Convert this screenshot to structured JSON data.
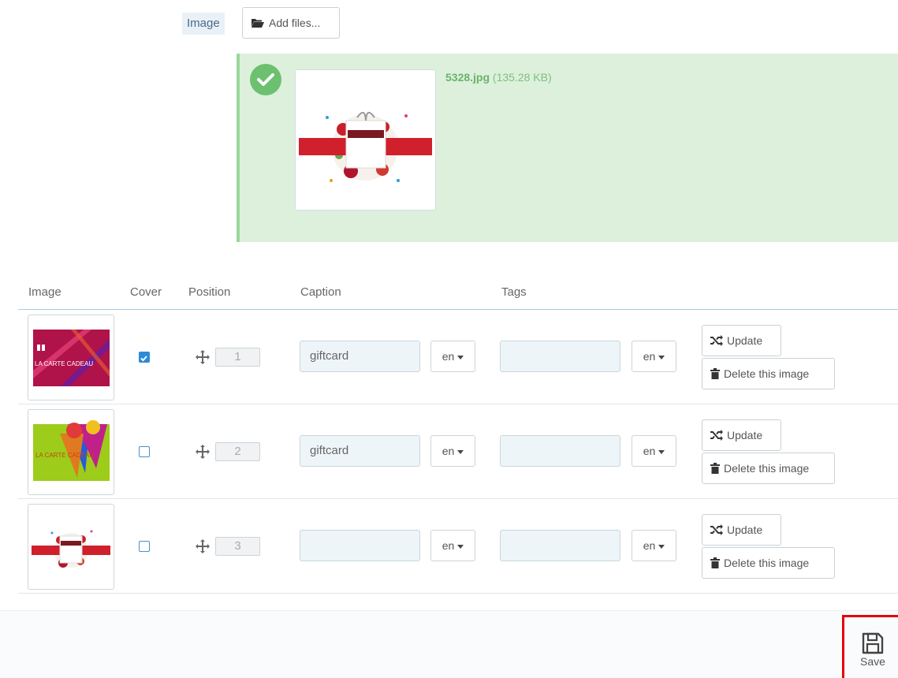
{
  "upload": {
    "field_label": "Image",
    "add_files_label": "Add files...",
    "file_name": "5328.jpg",
    "file_size": "(135.28 KB)"
  },
  "table": {
    "headers": [
      "Image",
      "Cover",
      "Position",
      "Caption",
      "Tags"
    ],
    "rows": [
      {
        "cover": true,
        "position": "1",
        "caption": "giftcard",
        "caption_lang": "en",
        "tags": "",
        "tags_lang": "en",
        "thumb_text": "LA CARTE CADEAU"
      },
      {
        "cover": false,
        "position": "2",
        "caption": "giftcard",
        "caption_lang": "en",
        "tags": "",
        "tags_lang": "en",
        "thumb_text": "LA CARTE CADEAU"
      },
      {
        "cover": false,
        "position": "3",
        "caption": "",
        "caption_lang": "en",
        "tags": "",
        "tags_lang": "en",
        "thumb_text": ""
      }
    ],
    "update_label": "Update",
    "delete_label": "Delete this image"
  },
  "footer": {
    "save_label": "Save"
  },
  "colors": {
    "success_bg": "#dcf0dc",
    "accent": "#2e8ad8",
    "highlight": "#e3000f"
  }
}
